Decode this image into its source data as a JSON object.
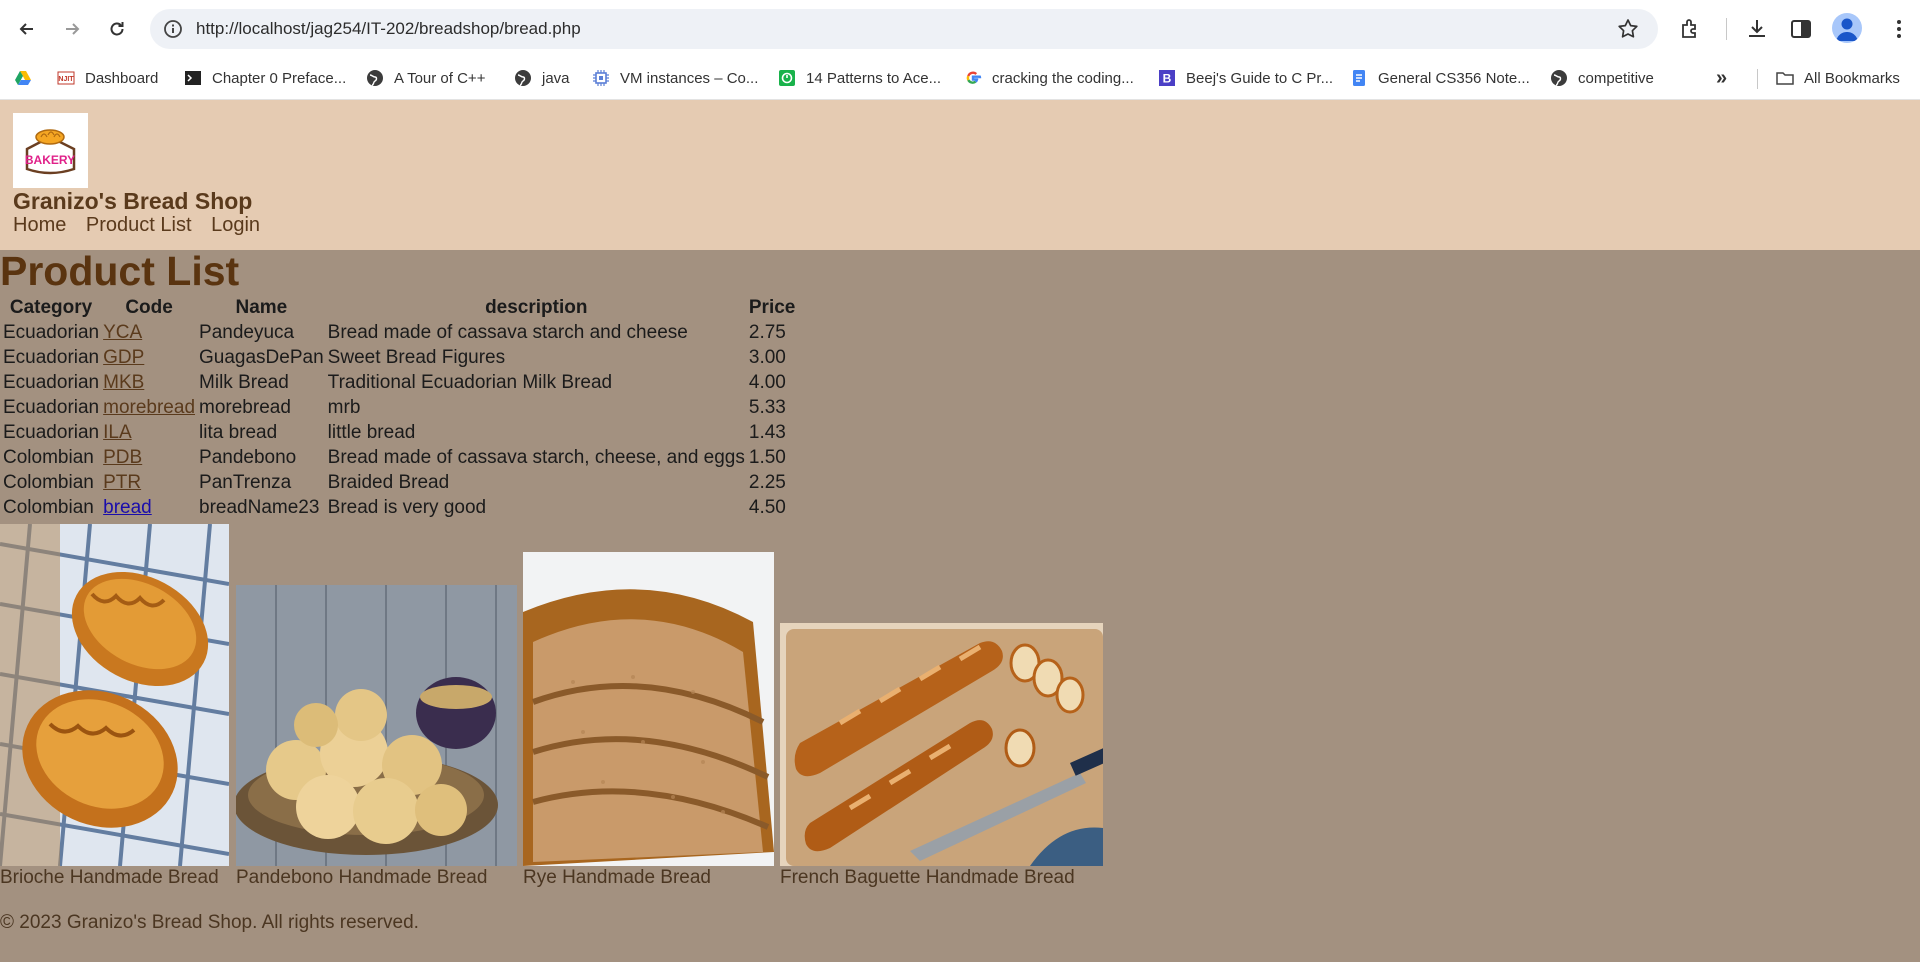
{
  "browser": {
    "url": "http://localhost/jag254/IT-202/breadshop/bread.php",
    "bookmarks": [
      {
        "label": "",
        "icon": "google-drive-icon"
      },
      {
        "label": "Dashboard",
        "icon": "njit-icon"
      },
      {
        "label": "Chapter 0 Preface...",
        "icon": "terminal-icon"
      },
      {
        "label": "A Tour of C++",
        "icon": "globe-icon"
      },
      {
        "label": "java",
        "icon": "globe-icon"
      },
      {
        "label": "VM instances – Co...",
        "icon": "cloud-compute-icon"
      },
      {
        "label": "14 Patterns to Ace...",
        "icon": "patterns-icon"
      },
      {
        "label": "cracking the coding...",
        "icon": "google-icon"
      },
      {
        "label": "Beej's Guide to C Pr...",
        "icon": "beej-icon"
      },
      {
        "label": "General CS356 Note...",
        "icon": "docs-icon"
      },
      {
        "label": "competitive",
        "icon": "globe-icon"
      }
    ],
    "more_label": "»",
    "all_bookmarks": "All Bookmarks"
  },
  "site": {
    "title": "Granizo's Bread Shop",
    "logo_text": "BAKERY",
    "nav": [
      "Home",
      "Product List",
      "Login"
    ]
  },
  "page_title": "Product List",
  "table": {
    "headers": [
      "Category",
      "Code",
      "Name",
      "description",
      "Price"
    ],
    "rows": [
      [
        "Ecuadorian",
        "YCA",
        "Pandeyuca",
        "Bread made of cassava starch and cheese",
        "2.75"
      ],
      [
        "Ecuadorian",
        "GDP",
        "GuagasDePan",
        "Sweet Bread Figures",
        "3.00"
      ],
      [
        "Ecuadorian",
        "MKB",
        "Milk Bread",
        "Traditional Ecuadorian Milk Bread",
        "4.00"
      ],
      [
        "Ecuadorian",
        "morebread",
        "morebread",
        "mrb",
        "5.33"
      ],
      [
        "Ecuadorian",
        "ILA",
        "lita bread",
        "little bread",
        "1.43"
      ],
      [
        "Colombian",
        "PDB",
        "Pandebono",
        "Bread made of cassava starch, cheese, and eggs",
        "1.50"
      ],
      [
        "Colombian",
        "PTR",
        "PanTrenza",
        "Braided Bread",
        "2.25"
      ],
      [
        "Colombian",
        "bread",
        "breadName23",
        "Bread is very good",
        "4.50"
      ]
    ]
  },
  "gallery": [
    {
      "caption": "Brioche Handmade Bread"
    },
    {
      "caption": "Pandebono Handmade Bread"
    },
    {
      "caption": "Rye Handmade Bread"
    },
    {
      "caption": "French Baguette Handmade Bread"
    }
  ],
  "footer": "© 2023 Granizo's Bread Shop. All rights reserved."
}
